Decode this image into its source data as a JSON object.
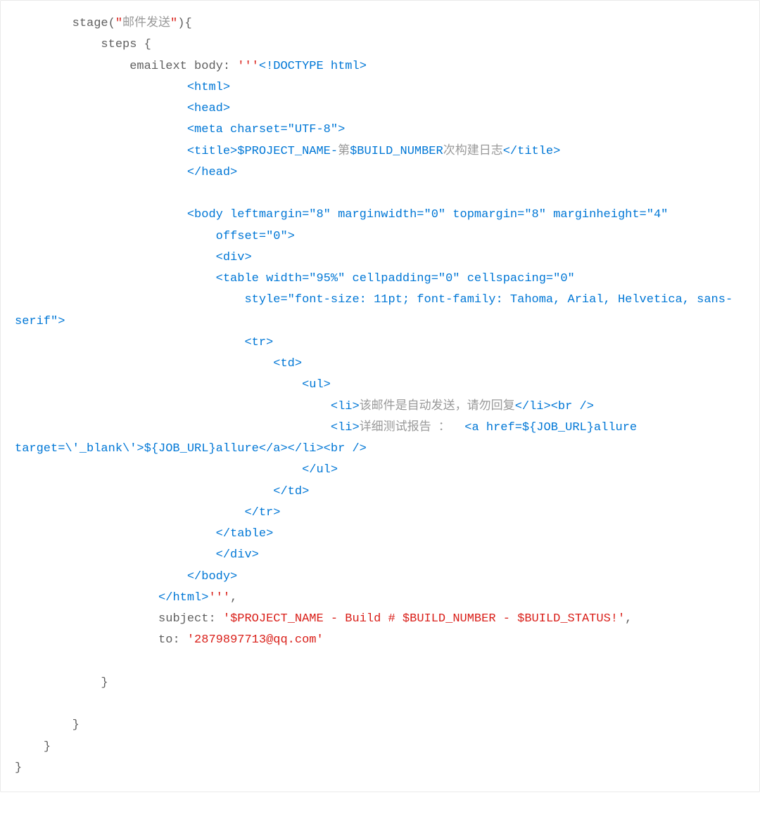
{
  "code": {
    "l1_stage": "        stage(",
    "l1_str1": "\"",
    "l1_cn": "邮件发送",
    "l1_str2": "\"",
    "l1_end": "){",
    "l2": "            steps {",
    "l3_a": "                emailext body: ",
    "l3_b": "'''",
    "l3_c": "<!DOCTYPE html>",
    "l4": "                        <html>",
    "l5": "                        <head>",
    "l6": "                        <meta charset=\"UTF-8\">",
    "l7_a": "                        <title>$PROJECT_NAME-",
    "l7_cn1": "第",
    "l7_b": "$BUILD_NUMBER",
    "l7_cn2": "次构建日志",
    "l7_c": "</title>",
    "l8": "                        </head>",
    "l9": "",
    "l10": "                        <body leftmargin=\"8\" marginwidth=\"0\" topmargin=\"8\" marginheight=\"4\"",
    "l11": "                            offset=\"0\">",
    "l12": "                            <div>",
    "l13": "                            <table width=\"95%\" cellpadding=\"0\" cellspacing=\"0\"",
    "l14": "                                style=\"font-size: 11pt; font-family: Tahoma, Arial, Helvetica, sans-serif\">",
    "l15": "                                <tr>",
    "l16": "                                    <td>",
    "l17": "                                        <ul>",
    "l18_a": "                                            <li>",
    "l18_cn": "该邮件是自动发送，请勿回复",
    "l18_b": "</li><br />",
    "l19_a": "                                            <li>",
    "l19_cn": "详细测试报告 ：",
    "l19_b": "  <a href=${JOB_URL}allure target=\\'_blank\\'>${JOB_URL}allure</a></li><br />",
    "l20": "                                        </ul>",
    "l21": "                                    </td>",
    "l22": "                                </tr>",
    "l23": "                            </table>",
    "l24": "                            </div>",
    "l25": "                        </body>",
    "l26_a": "                    </html>",
    "l26_b": "'''",
    "l26_c": ",",
    "l27_a": "                    subject: ",
    "l27_b": "'$PROJECT_NAME - Build # $BUILD_NUMBER - $BUILD_STATUS!'",
    "l27_c": ",",
    "l28_a": "                    to: ",
    "l28_b": "'2879897713@qq.com'",
    "l29": "",
    "l30": "            }",
    "l31": "",
    "l32": "        }",
    "l33": "    }",
    "l34": "}"
  }
}
